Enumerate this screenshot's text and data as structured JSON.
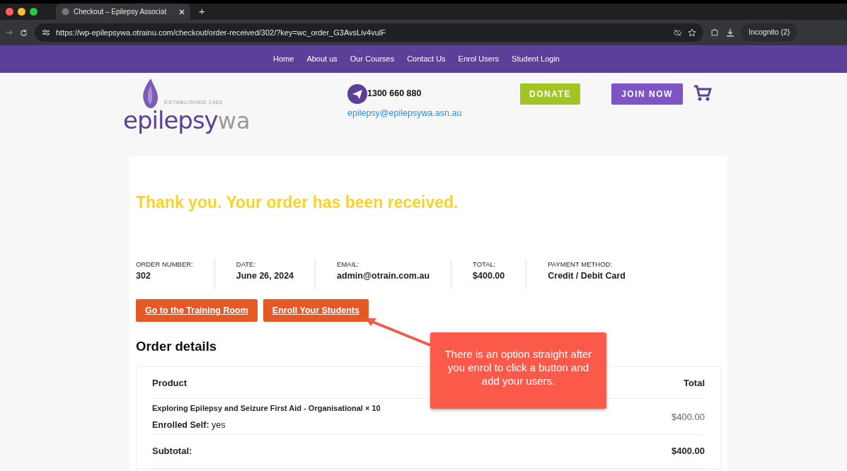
{
  "browser": {
    "tab_title": "Checkout – Epilepsy Associat",
    "new_tab": "+",
    "url": "https://wp-epilepsywa.otrainu.com/checkout/order-received/302/?key=wc_order_G3AvsLiv4vulF",
    "profile": "Incognito (2)"
  },
  "nav": [
    {
      "label": "Home"
    },
    {
      "label": "About us"
    },
    {
      "label": "Our Courses"
    },
    {
      "label": "Contact Us"
    },
    {
      "label": "Enrol Users"
    },
    {
      "label": "Student Login"
    }
  ],
  "header": {
    "logo_main": "epilepsy",
    "logo_suffix": "wa",
    "logo_tagline": "ESTABLISHED 1963",
    "phone": "1300 660 880",
    "email": "epilepsy@epilepsywa.asn.au",
    "donate": "DONATE",
    "join": "JOIN NOW"
  },
  "order": {
    "heading": "Thank you. Your order has been received.",
    "overview": [
      {
        "label": "ORDER NUMBER:",
        "value": "302"
      },
      {
        "label": "DATE:",
        "value": "June 26, 2024"
      },
      {
        "label": "EMAIL:",
        "value": "admin@otrain.com.au"
      },
      {
        "label": "TOTAL:",
        "value": "$400.00"
      },
      {
        "label": "PAYMENT METHOD:",
        "value": "Credit / Debit Card"
      }
    ],
    "buttons": [
      "Go to the Training Room",
      "Enroll Your Students"
    ],
    "details_heading": "Order details",
    "table": {
      "columns": [
        "Product",
        "Total"
      ],
      "item": {
        "name": "Exploring Epilepsy and Seizure First Aid - Organisational × 10",
        "meta": "**Enrolled Self:** yes",
        "total": "$400.00"
      },
      "subtotal": {
        "label": "Subtotal:",
        "value": "$400.00"
      }
    }
  },
  "callout": {
    "text": "There is an option straight after you enrol to click a button and add your users."
  }
}
